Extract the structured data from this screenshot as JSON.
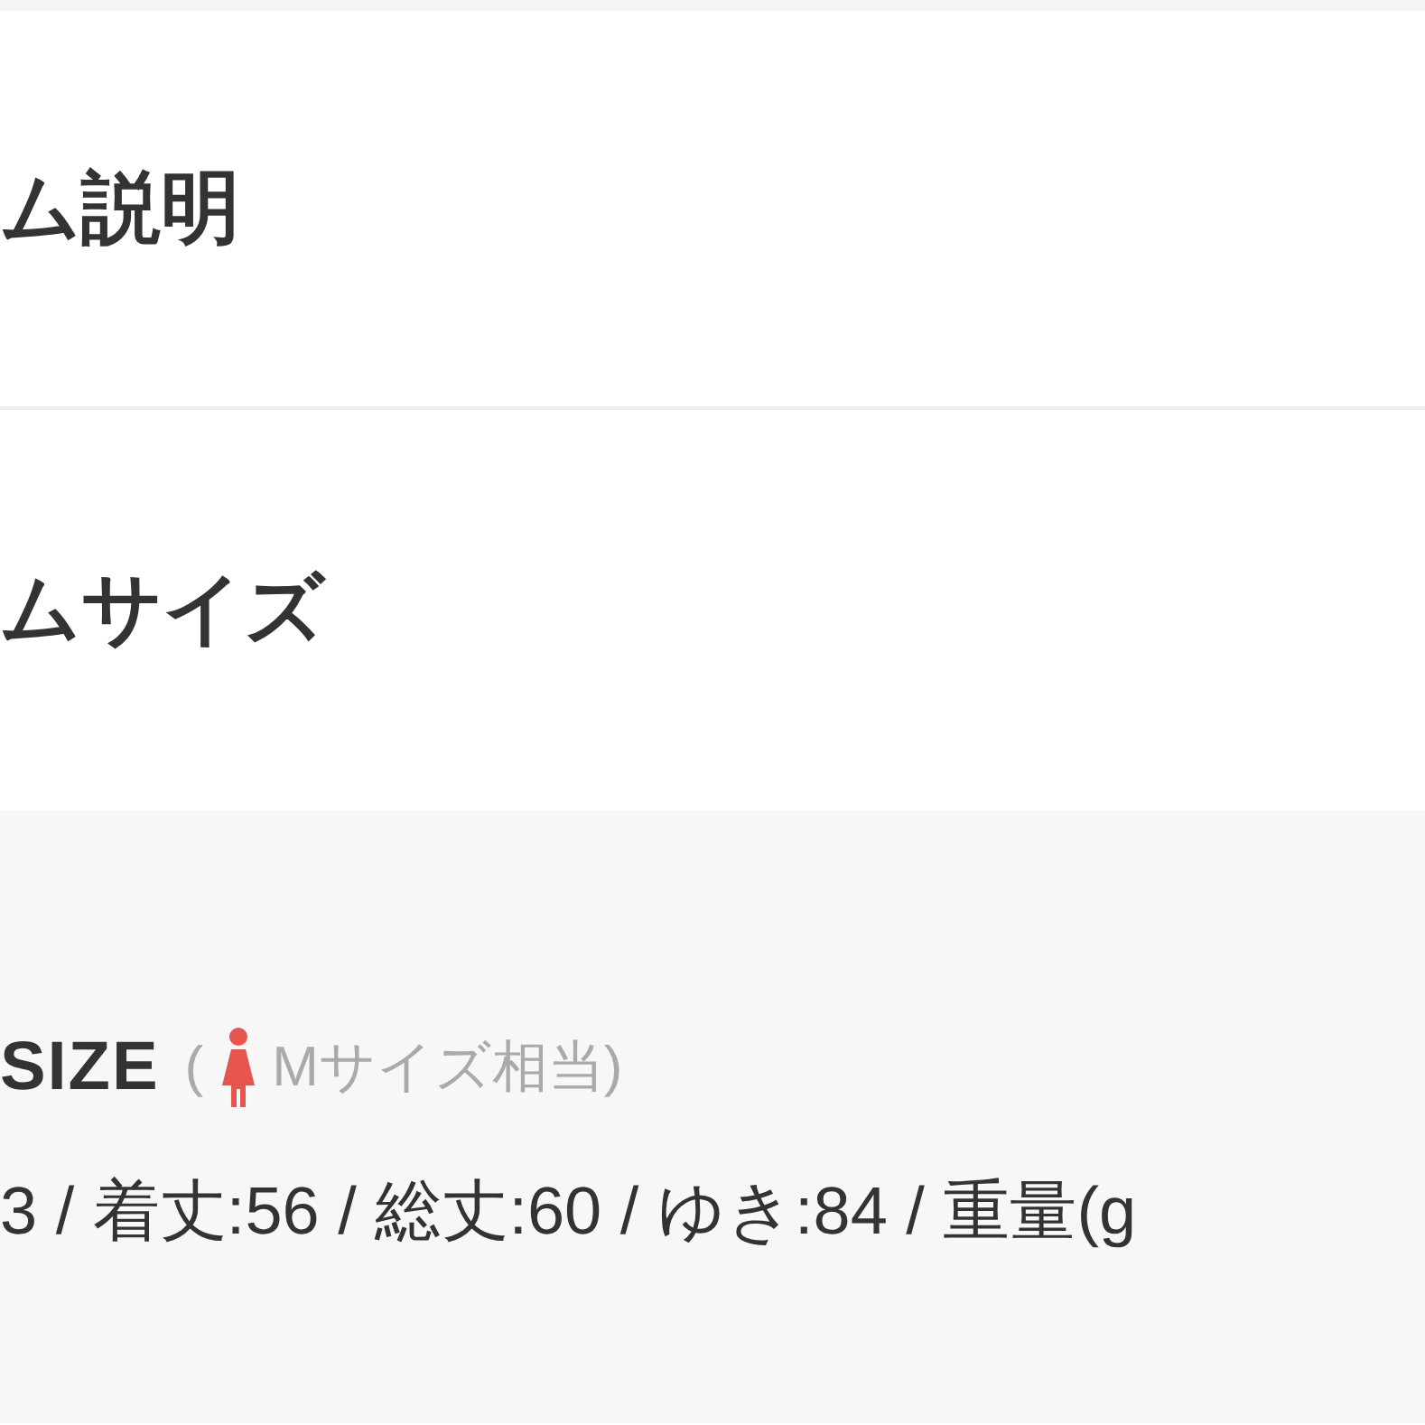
{
  "sections": [
    {
      "title": "ム説明"
    },
    {
      "title": "ムサイズ"
    }
  ],
  "size_panel": {
    "label": "SIZE",
    "paren": "(",
    "note": "Mサイズ相当)",
    "measurements": "3 / 着丈:56 / 総丈:60 / ゆき:84 / 重量(g"
  }
}
